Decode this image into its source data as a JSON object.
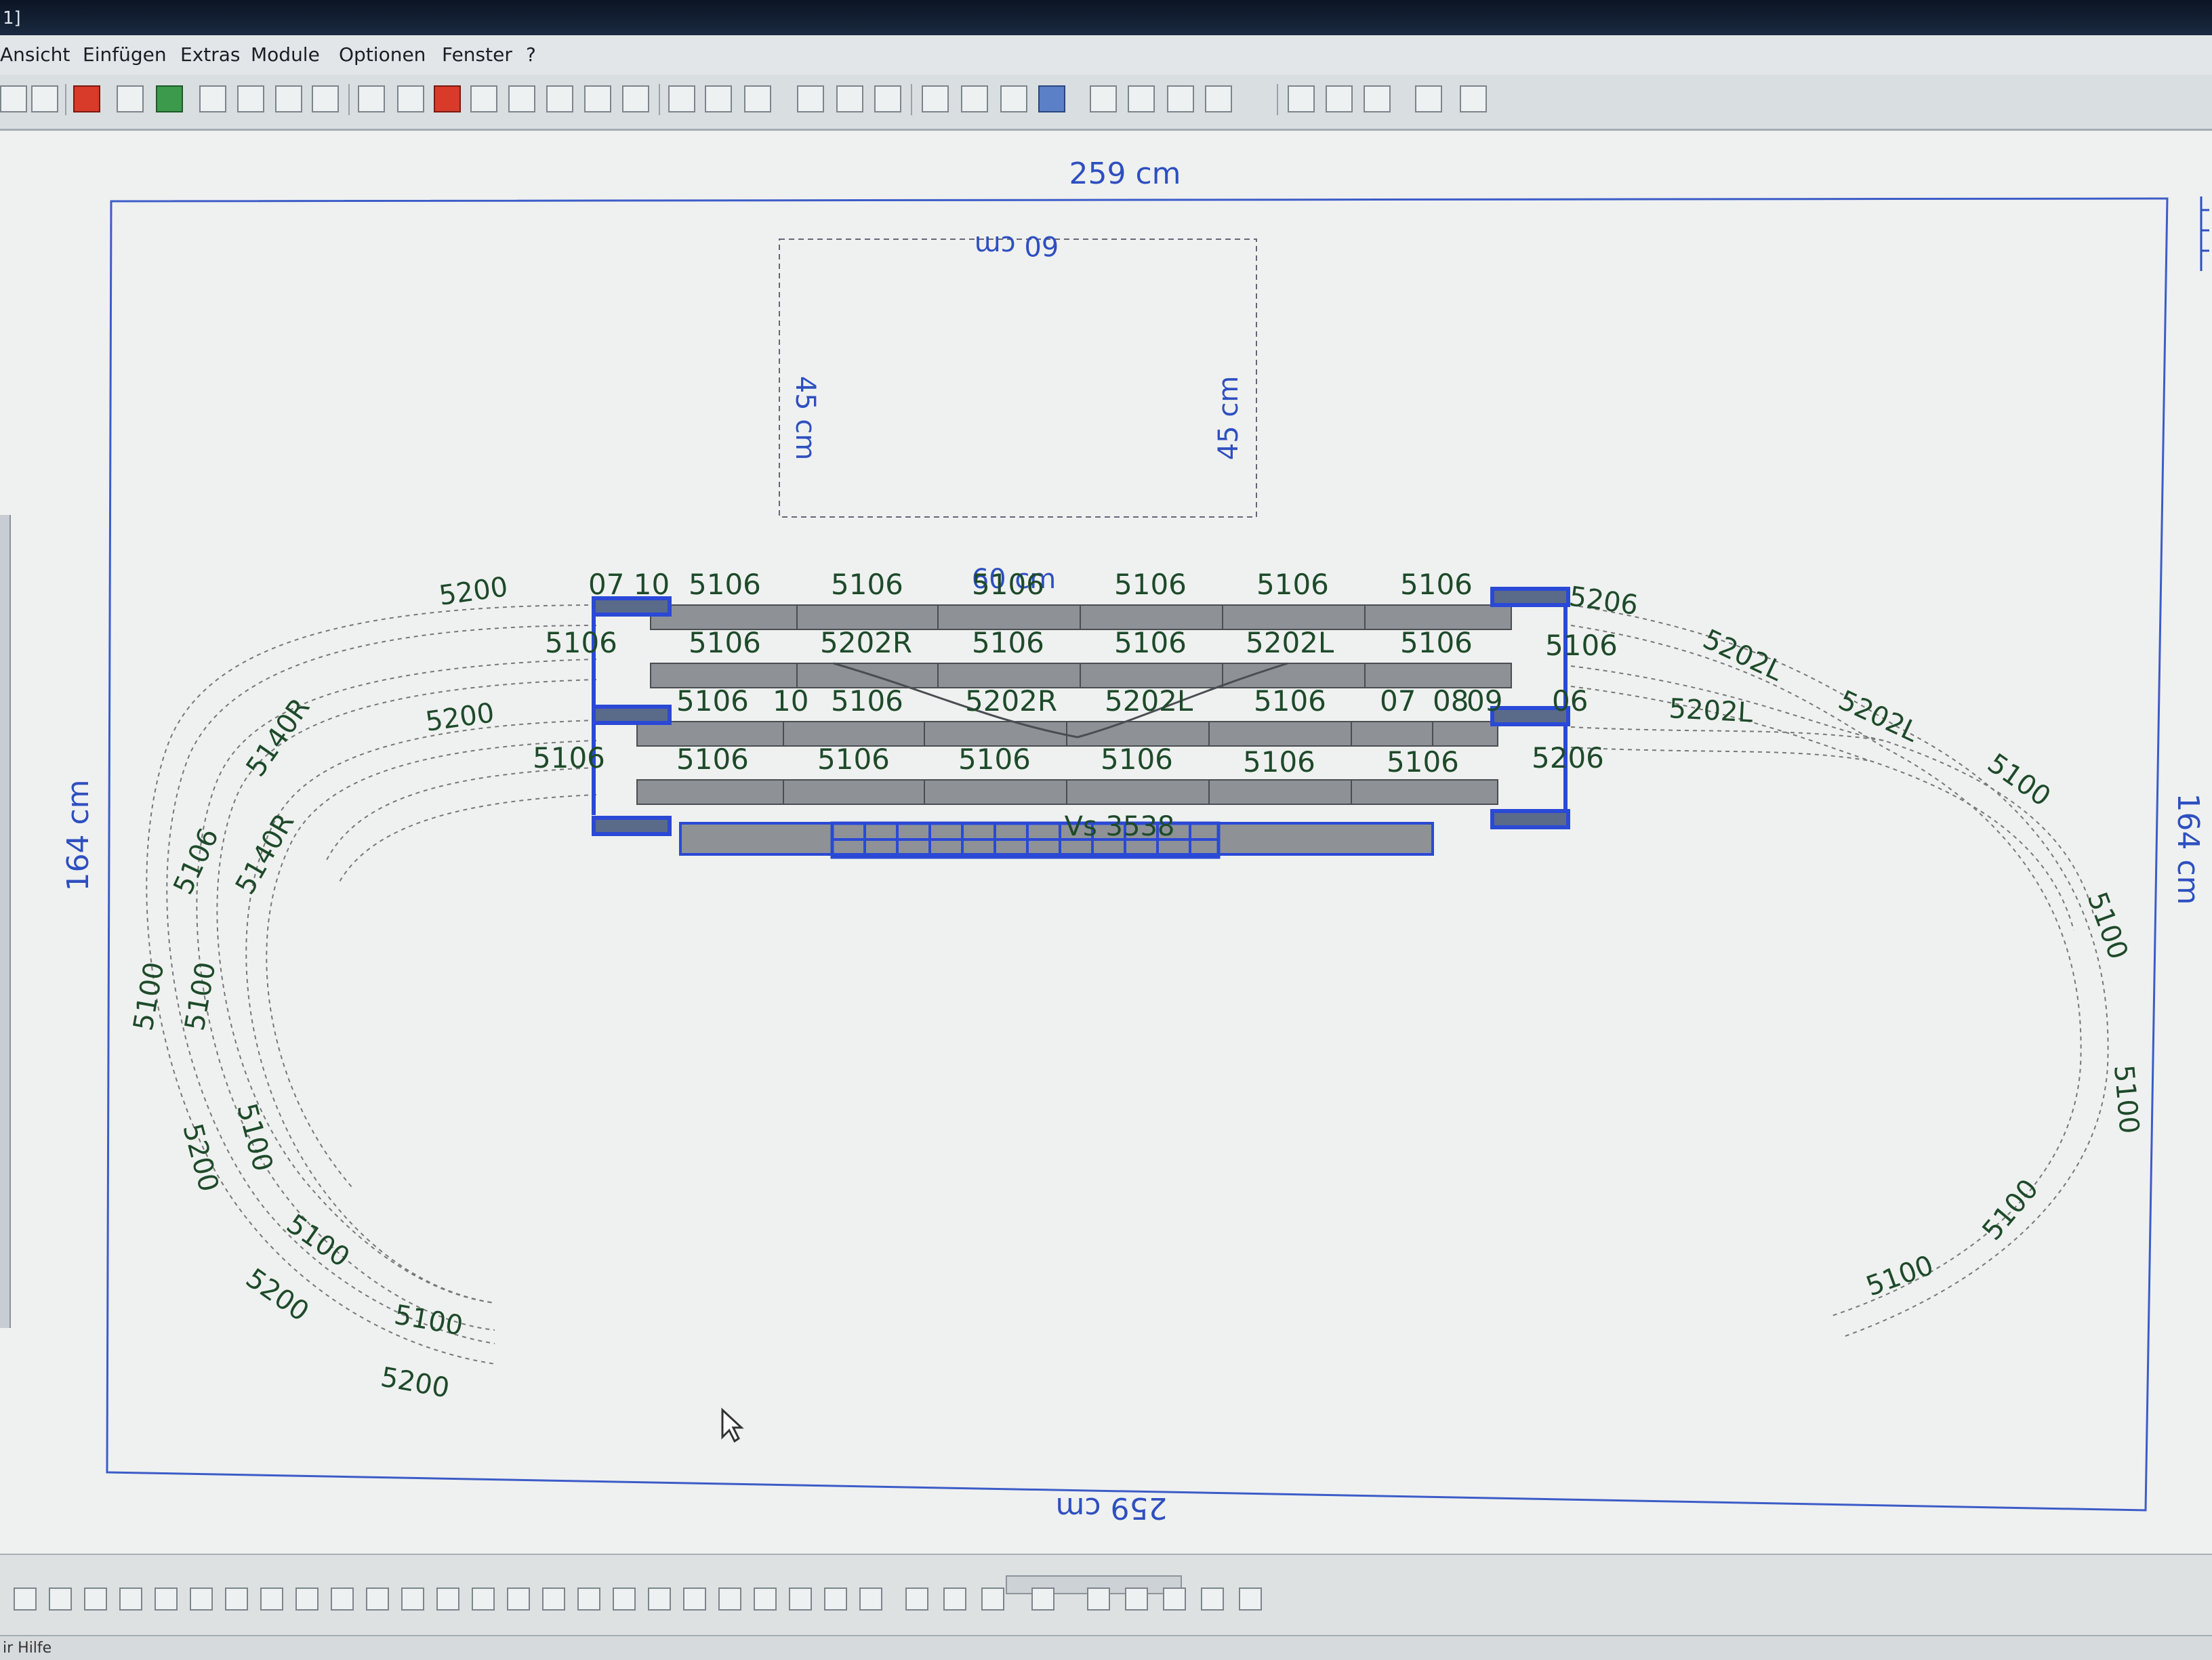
{
  "window": {
    "title_fragment": "1]"
  },
  "menu": [
    {
      "label": "Ansicht"
    },
    {
      "label": "Einfügen"
    },
    {
      "label": "Extras"
    },
    {
      "label": "Module"
    },
    {
      "label": "Optionen"
    },
    {
      "label": "Fenster"
    },
    {
      "label": "?"
    }
  ],
  "toolbar": {
    "icons": [
      "print-icon",
      "page-icon",
      "open-icon",
      "chart-icon",
      "landscape-icon",
      "zoom-out-icon",
      "zoom-in-icon",
      "zoom-window-icon",
      "zoom-fit-icon",
      "undo-icon",
      "redo-icon",
      "delete-icon",
      "copy-icon",
      "paste-icon",
      "cut-icon",
      "clipboard-icon",
      "module-icon",
      "track-switch-icon",
      "curve-icon",
      "flex-track-icon",
      "rotate-icon",
      "align-icon",
      "grid-icon",
      "measure-icon",
      "connect-icon",
      "help-context-icon"
    ]
  },
  "dimensions": {
    "top_width": "259 cm",
    "bottom_width": "259 cm",
    "left_height": "164 cm",
    "right_height": "164 cm",
    "box_top": "60 cm",
    "box_left": "45 cm",
    "box_right": "45 cm",
    "box_bottom": "60 cm"
  },
  "station_label": "Vs 3538",
  "track_labels": {
    "row1": [
      "07 10",
      "5106",
      "5106",
      "5106",
      "5106",
      "5106",
      "5106"
    ],
    "row2": [
      "5106",
      "5106",
      "5202R",
      "5106",
      "5106",
      "5202L",
      "5106",
      "5106"
    ],
    "row3": [
      "5106",
      "10",
      "5106",
      "5202R",
      "5202L",
      "5106",
      "07",
      "08",
      "09",
      "06"
    ],
    "row4": [
      "5106",
      "5106",
      "5106",
      "5106",
      "5106",
      "5106",
      "5106",
      "5206"
    ],
    "left_curve": [
      "5200",
      "5200",
      "5140R",
      "5140R",
      "5106",
      "5100",
      "5100",
      "5200",
      "5100",
      "5100",
      "5200",
      "5100",
      "5200"
    ],
    "right_curve": [
      "5206",
      "5202L",
      "5202L",
      "5202L",
      "5100",
      "5100",
      "5100",
      "5100",
      "5100"
    ]
  },
  "status": {
    "text": "ir Hilfe"
  },
  "colors": {
    "dimension_blue": "#2e4fc0",
    "track_gray": "#8e9296",
    "label_green": "#1e4a2a",
    "selection_blue": "#2a49d6"
  }
}
